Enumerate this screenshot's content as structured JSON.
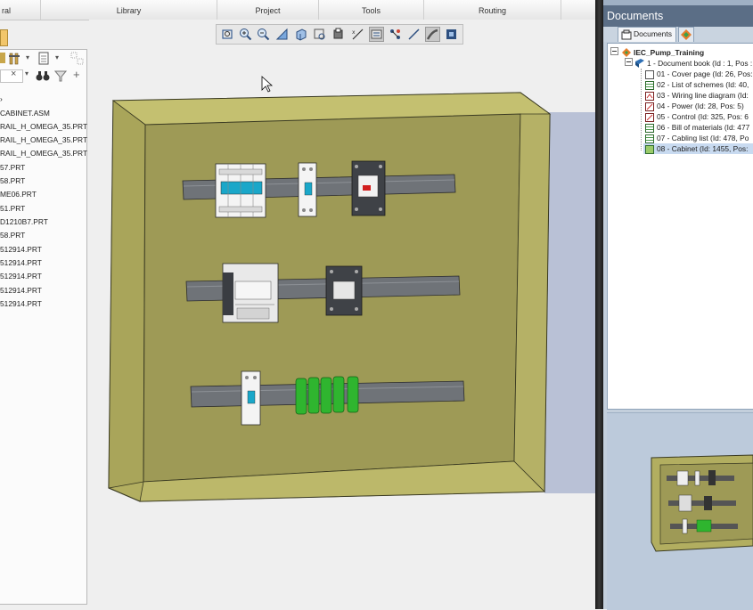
{
  "menu": {
    "tab_general": "ral",
    "tab_library": "Library",
    "tab_project": "Project",
    "tab_tools": "Tools",
    "tab_routing": "Routing"
  },
  "tree": {
    "root_partial": "",
    "items": [
      "CABINET.ASM",
      "RAIL_H_OMEGA_35.PRT",
      "RAIL_H_OMEGA_35.PRT",
      "RAIL_H_OMEGA_35.PRT",
      "57.PRT",
      "58.PRT",
      "ME06.PRT",
      "51.PRT",
      "D1210B7.PRT",
      "58.PRT",
      "512914.PRT",
      "512914.PRT",
      "512914.PRT",
      "512914.PRT",
      "512914.PRT"
    ],
    "filter_clear": "×"
  },
  "documents": {
    "title": "Documents",
    "tab_label": "Documents",
    "project": "IEC_Pump_Training",
    "book": "1 - Document book (Id : 1, Pos :",
    "items": [
      "01 - Cover page (Id: 26, Pos:",
      "02 - List of schemes (Id: 40,",
      "03 - Wiring line diagram (Id:",
      "04 - Power (Id: 28, Pos: 5)",
      "05 - Control (Id: 325, Pos: 6",
      "06 - Bill of materials (Id: 477",
      "07 - Cabling list (Id: 478, Po",
      "08 - Cabinet (Id: 1455, Pos:"
    ],
    "selected_index": 7
  },
  "colors": {
    "panel_face": "#9e9a56",
    "panel_rim": "#bcb86a",
    "rail": "#6f7378",
    "terminal_green": "#2fb52f",
    "selection": "#c8daf0"
  }
}
